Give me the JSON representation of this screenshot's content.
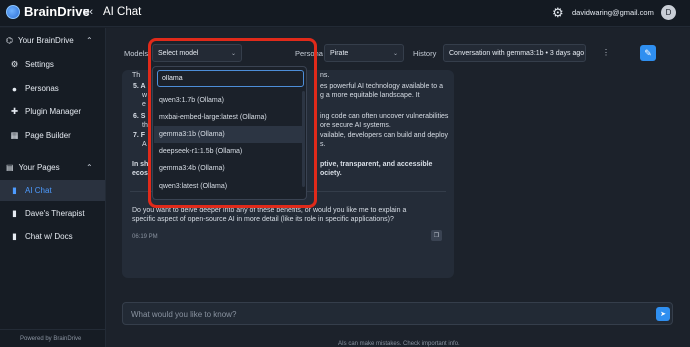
{
  "header": {
    "logo_text": "BrainDrive",
    "app_title": "AI Chat",
    "user_email": "davidwaring@gmail.com",
    "avatar_initial": "D",
    "collapse_icon": "menu-collapse-icon",
    "settings_icon": "gear-icon"
  },
  "sidebar": {
    "section1": {
      "label": "Your BrainDrive",
      "icon": "brain-icon"
    },
    "items1": [
      {
        "label": "Settings",
        "icon": "gear-icon"
      },
      {
        "label": "Personas",
        "icon": "person-icon"
      },
      {
        "label": "Plugin Manager",
        "icon": "puzzle-icon"
      },
      {
        "label": "Page Builder",
        "icon": "layout-icon"
      }
    ],
    "section2": {
      "label": "Your Pages",
      "icon": "pages-icon"
    },
    "items2": [
      {
        "label": "AI Chat",
        "icon": "document-icon",
        "active": true
      },
      {
        "label": "Dave's Therapist",
        "icon": "document-icon"
      },
      {
        "label": "Chat w/ Docs",
        "icon": "document-icon"
      }
    ],
    "powered_by": "Powered by BrainDrive"
  },
  "toolbar": {
    "models_label": "Models",
    "model_select": "Select model",
    "persona_label": "Persona",
    "persona_select": "Pirate",
    "history_label": "History",
    "history_select": "Conversation with gemma3:1b • 3 days ago",
    "more_icon": "more-vertical-icon",
    "new_chat_icon": "edit-icon"
  },
  "dropdown": {
    "search_value": "ollama",
    "options": [
      "qwen3:1.7b (Ollama)",
      "mxbai-embed-large:latest (Ollama)",
      "gemma3:1b (Ollama)",
      "deepseek-r1:1.5b (Ollama)",
      "gemma3:4b (Ollama)",
      "qwen3:latest (Ollama)"
    ],
    "selected_index": 2
  },
  "chat": {
    "visible_fragments": {
      "l1_left": "Th",
      "l1_right": "ns.",
      "l2_left": "5. A",
      "l2_right": "es powerful AI technology available to a",
      "l3_left": "w",
      "l3_right": "g a more equitable landscape. It",
      "l4_left": "e",
      "l5_left": "6. S",
      "l5_right": "ing code can often uncover vulnerabilities",
      "l6_left": "th",
      "l6_right": "ore secure AI systems.",
      "l7_left": "7. F",
      "l7_right": "vailable, developers can build and deploy",
      "l8_left": "A",
      "l8_right": "s.",
      "l9_left": "In sh",
      "l9_right": "ptive, transparent, and accessible",
      "l10_left": "ecos",
      "l10_right": "ociety."
    },
    "followup_line1": "Do you want to delve deeper into any of these benefits, or would you like me to explain a",
    "followup_line2": "specific aspect of open-source AI in more detail (like its role in specific applications)?",
    "timestamp": "06:19 PM",
    "copy_icon": "copy-icon"
  },
  "input": {
    "placeholder": "What would you like to know?",
    "value": "",
    "send_icon": "send-icon"
  },
  "disclaimer": "AIs can make mistakes. Check important info."
}
